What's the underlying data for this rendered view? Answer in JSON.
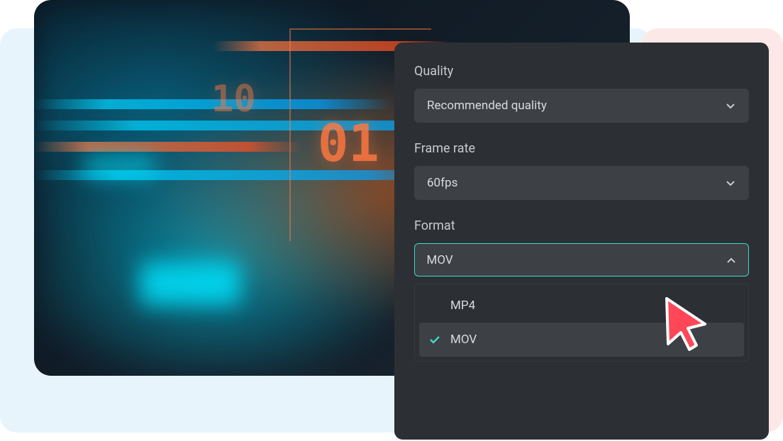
{
  "settings": {
    "quality": {
      "label": "Quality",
      "value": "Recommended quality"
    },
    "framerate": {
      "label": "Frame rate",
      "value": "60fps"
    },
    "format": {
      "label": "Format",
      "value": "MOV",
      "options": [
        {
          "label": "MP4",
          "selected": false
        },
        {
          "label": "MOV",
          "selected": true
        }
      ]
    }
  },
  "decorative": {
    "digits_main": "01",
    "digits_secondary": "10"
  }
}
